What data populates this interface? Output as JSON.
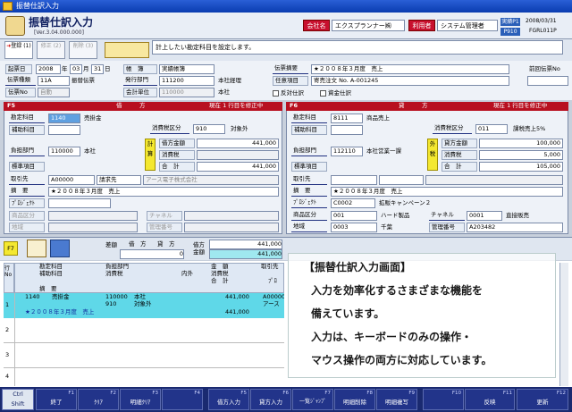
{
  "window": {
    "title": "振替仕訳入力"
  },
  "header": {
    "app_title": "振替仕訳入力",
    "version": "[Ver.3.04.000.000]",
    "company_label": "会社名",
    "company_value": "エクスプランナー㈱",
    "user_label": "利用者",
    "user_value": "システム管理者",
    "env_label1": "実績P1",
    "env_label2": "P910",
    "date": "2008/03/31",
    "code": "FGRL011P"
  },
  "toolbar": {
    "register": "登録\n(1)",
    "correct": "修正\n(2)",
    "delete": "削除\n(3)",
    "message": "計上したい勘定科目を設定します。"
  },
  "form": {
    "entry_date_label": "起票日",
    "entry_year": "2008",
    "year_unit": "年",
    "entry_month": "03",
    "month_unit": "月",
    "entry_day": "31",
    "day_unit": "日",
    "slip_type_label": "伝票種類",
    "slip_type_code": "11A",
    "slip_type_name": "振替伝票",
    "slip_no_label": "伝票No",
    "slip_no_value": "自動",
    "book_label": "帳　簿",
    "book_value": "実績帳簿",
    "issue_dept_label": "発行部門",
    "issue_dept_code": "111200",
    "issue_dept_name": "本社経理",
    "acct_unit_label": "会計単位",
    "acct_unit_code": "110000",
    "acct_unit_name": "本社",
    "summary_label": "伝票摘要",
    "summary_value": "★２００８年３月度　売上",
    "doc_label": "任意項目",
    "doc_value": "寄売注文 No. A-001245",
    "prev_label": "前回伝票No",
    "reverse_label": "反対仕訳",
    "asset_label": "資金仕訳"
  },
  "debit": {
    "fkey": "F5",
    "title": "借　　　方",
    "status": "現在 1 行目を修正中",
    "acct_label": "勘定科目",
    "acct_code": "1140",
    "acct_name": "売掛金",
    "sub_label": "補助科目",
    "tax_label": "消費税区分",
    "tax_code": "910",
    "tax_name": "対象外",
    "dept_label": "負担部門",
    "dept_code": "110000",
    "dept_name": "本社",
    "amount_side": "計算",
    "amt_label": "借方金額",
    "amt_value": "441,000",
    "tax_amt_label": "消費税",
    "total_label": "合　計",
    "total_value": "441,000",
    "std_label": "標準項目",
    "partner_label": "取引先",
    "partner_code": "A00000",
    "partner_type": "請求先",
    "partner_name": "アース電子株式会社",
    "memo_label": "摘　要",
    "memo_value": "★２００８年３月度　売上",
    "project_label": "ﾌﾟﾛｼﾞｪｸﾄ",
    "product_label": "商品区分",
    "channel_label": "チャネル",
    "area_label": "地域",
    "mgmt_label": "管理番号"
  },
  "credit": {
    "fkey": "F6",
    "title": "貸　　　方",
    "status": "現在 1 行目を修正中",
    "acct_label": "勘定科目",
    "acct_code": "8111",
    "acct_name": "商品売上",
    "sub_label": "補助科目",
    "tax_label": "消費税区分",
    "tax_code": "011",
    "tax_name": "課税売上5%",
    "dept_label": "負担部門",
    "dept_code": "112110",
    "dept_name": "本社営業一課",
    "amount_side": "外税",
    "amt_label": "貸方金額",
    "amt_value": "100,000",
    "tax_amt_label": "消費税",
    "tax_amt_value": "5,000",
    "total_label": "合　計",
    "total_value": "105,000",
    "std_label": "標準項目",
    "partner_label": "取引先",
    "memo_label": "摘　要",
    "memo_value": "★２００８年３月度　売上",
    "project_label": "ﾌﾟﾛｼﾞｪｸﾄ",
    "project_code": "C0002",
    "project_name": "拡販キャンペーン２",
    "product_label": "商品区分",
    "product_code": "001",
    "product_name": "ハード製品",
    "channel_label": "チャネル",
    "channel_code": "0001",
    "channel_name": "直接販売",
    "area_label": "地域",
    "area_code": "0003",
    "area_name": "千葉",
    "mgmt_label": "管理番号",
    "mgmt_value": "A203482"
  },
  "summary_bar": {
    "fkey": "F7",
    "diff_label": "差額",
    "debit_label": "借　方",
    "credit_label": "貸　方",
    "diff_value": "0",
    "amt_label": "借方金額",
    "total1": "441,000",
    "total2": "441,000"
  },
  "grid": {
    "row_label": "行No",
    "headers": {
      "acct": "勘定科目",
      "sub": "補助科目",
      "dept": "負担部門",
      "tax": "消費税",
      "inner": "内外",
      "amount": "金　額",
      "tax_amt": "消費税",
      "total": "合　計",
      "partner": "取引先",
      "memo": "摘　要",
      "proj": "ﾌﾟﾛ"
    },
    "rows": [
      {
        "no": "1",
        "acct_code": "1140",
        "acct_name": "売掛金",
        "dept_code": "110000",
        "dept_name": "本社",
        "tax_code": "910",
        "tax_name": "対象外",
        "amount": "441,000",
        "total": "441,000",
        "partner": "A00000",
        "partner2": "アース",
        "memo": "★２００８年３月度　売上"
      },
      {
        "no": "2"
      },
      {
        "no": "3"
      },
      {
        "no": "4"
      }
    ]
  },
  "overlay": {
    "title": "【振替仕訳入力画面】",
    "line1": "入力を効率化するさまざまな機能を",
    "line2": "備えています。",
    "line3": "入力は、キーボードのみの操作・",
    "line4": "マウス操作の両方に対応しています。"
  },
  "fkeys": [
    {
      "n": "Ctrl",
      "l": "Shift"
    },
    {
      "n": "F1",
      "l": "終了"
    },
    {
      "n": "F2",
      "l": "ｸﾘｱ"
    },
    {
      "n": "F3",
      "l": "明細ｸﾘｱ"
    },
    {
      "n": "F4",
      "l": ""
    },
    {
      "n": "F5",
      "l": "借方入力"
    },
    {
      "n": "F6",
      "l": "貸方入力"
    },
    {
      "n": "F7",
      "l": "一覧ｼﾞｬﾝﾌﾟ"
    },
    {
      "n": "F8",
      "l": "明細削除"
    },
    {
      "n": "F9",
      "l": "明細複写"
    },
    {
      "n": "F10",
      "l": ""
    },
    {
      "n": "F11",
      "l": "反映"
    },
    {
      "n": "F12",
      "l": "更新"
    }
  ]
}
